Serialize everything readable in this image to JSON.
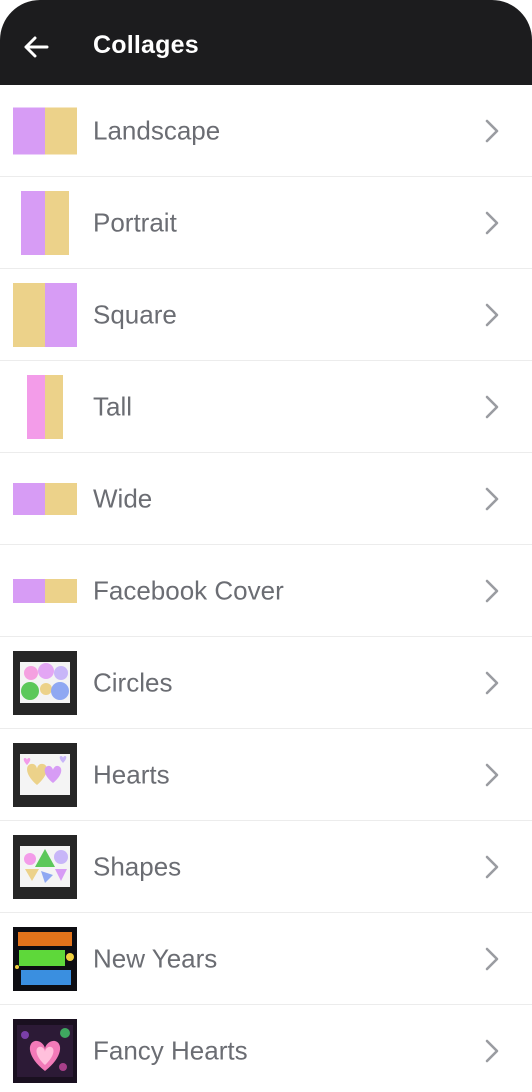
{
  "appbar": {
    "title": "Collages",
    "back_icon": "arrow-left-icon"
  },
  "colors": {
    "purple": "#d79cf5",
    "yellow": "#ecd28a",
    "pink": "#f39ce9",
    "header": "#1c1c1e"
  },
  "items": [
    {
      "label": "Landscape",
      "icon": "landscape-collage-icon"
    },
    {
      "label": "Portrait",
      "icon": "portrait-collage-icon"
    },
    {
      "label": "Square",
      "icon": "square-collage-icon"
    },
    {
      "label": "Tall",
      "icon": "tall-collage-icon"
    },
    {
      "label": "Wide",
      "icon": "wide-collage-icon"
    },
    {
      "label": "Facebook Cover",
      "icon": "facebook-cover-collage-icon"
    },
    {
      "label": "Circles",
      "icon": "circles-collage-thumbnail"
    },
    {
      "label": "Hearts",
      "icon": "hearts-collage-thumbnail"
    },
    {
      "label": "Shapes",
      "icon": "shapes-collage-thumbnail"
    },
    {
      "label": "New Years",
      "icon": "new-years-collage-thumbnail"
    },
    {
      "label": "Fancy Hearts",
      "icon": "fancy-hearts-collage-thumbnail"
    }
  ],
  "chevron_icon": "chevron-right-icon"
}
